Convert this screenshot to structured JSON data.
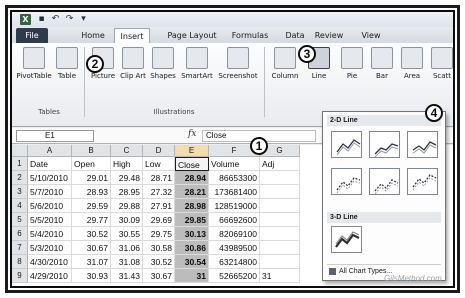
{
  "qat": {
    "excel_icon": "excel-icon",
    "save_icon": "save-icon",
    "undo_icon": "undo-icon",
    "redo_icon": "redo-icon",
    "customize_icon": "chevron-down-icon"
  },
  "tabs": [
    {
      "label": "File"
    },
    {
      "label": "Home"
    },
    {
      "label": "Insert"
    },
    {
      "label": "Page Layout"
    },
    {
      "label": "Formulas"
    },
    {
      "label": "Data"
    },
    {
      "label": "Review"
    },
    {
      "label": "View"
    }
  ],
  "ribbon": {
    "buttons": [
      {
        "label": "PivotTable"
      },
      {
        "label": "Table"
      },
      {
        "label": "Picture"
      },
      {
        "label": "Clip Art"
      },
      {
        "label": "Shapes"
      },
      {
        "label": "SmartArt"
      },
      {
        "label": "Screenshot"
      },
      {
        "label": "Column"
      },
      {
        "label": "Line"
      },
      {
        "label": "Pie"
      },
      {
        "label": "Bar"
      },
      {
        "label": "Area"
      },
      {
        "label": "Scatt"
      }
    ],
    "groups": {
      "tables": "Tables",
      "illustrations": "Illustrations"
    }
  },
  "formula_bar": {
    "name_box": "E1",
    "fx": "fx",
    "content": "Close"
  },
  "grid": {
    "columns": [
      "A",
      "B",
      "C",
      "D",
      "E",
      "F",
      "G"
    ],
    "rows": [
      {
        "n": "1",
        "cells": [
          "Date",
          "Open",
          "High",
          "Low",
          "Close",
          "Volume",
          "Adj"
        ]
      },
      {
        "n": "2",
        "cells": [
          "5/10/2010",
          "29.01",
          "29.48",
          "28.71",
          "28.94",
          "86653300",
          ""
        ]
      },
      {
        "n": "3",
        "cells": [
          "5/7/2010",
          "28.93",
          "28.95",
          "27.32",
          "28.21",
          "173681400",
          ""
        ]
      },
      {
        "n": "4",
        "cells": [
          "5/6/2010",
          "29.59",
          "29.88",
          "27.91",
          "28.98",
          "128519000",
          ""
        ]
      },
      {
        "n": "5",
        "cells": [
          "5/5/2010",
          "29.77",
          "30.09",
          "29.69",
          "29.85",
          "66692600",
          ""
        ]
      },
      {
        "n": "6",
        "cells": [
          "5/4/2010",
          "30.52",
          "30.55",
          "29.75",
          "30.13",
          "82069100",
          ""
        ]
      },
      {
        "n": "7",
        "cells": [
          "5/3/2010",
          "30.67",
          "31.06",
          "30.58",
          "30.86",
          "43989500",
          ""
        ]
      },
      {
        "n": "8",
        "cells": [
          "4/30/2010",
          "31.07",
          "31.08",
          "30.52",
          "30.54",
          "63214800",
          ""
        ]
      },
      {
        "n": "9",
        "cells": [
          "4/29/2010",
          "30.93",
          "31.43",
          "30.67",
          "31",
          "52665200",
          "31"
        ]
      }
    ]
  },
  "dropdown": {
    "section_2d": "2-D Line",
    "section_3d": "3-D Line",
    "footer": "All Chart Types..."
  },
  "callouts": [
    "1",
    "2",
    "3",
    "4"
  ],
  "watermark": "GilsMethod.com"
}
